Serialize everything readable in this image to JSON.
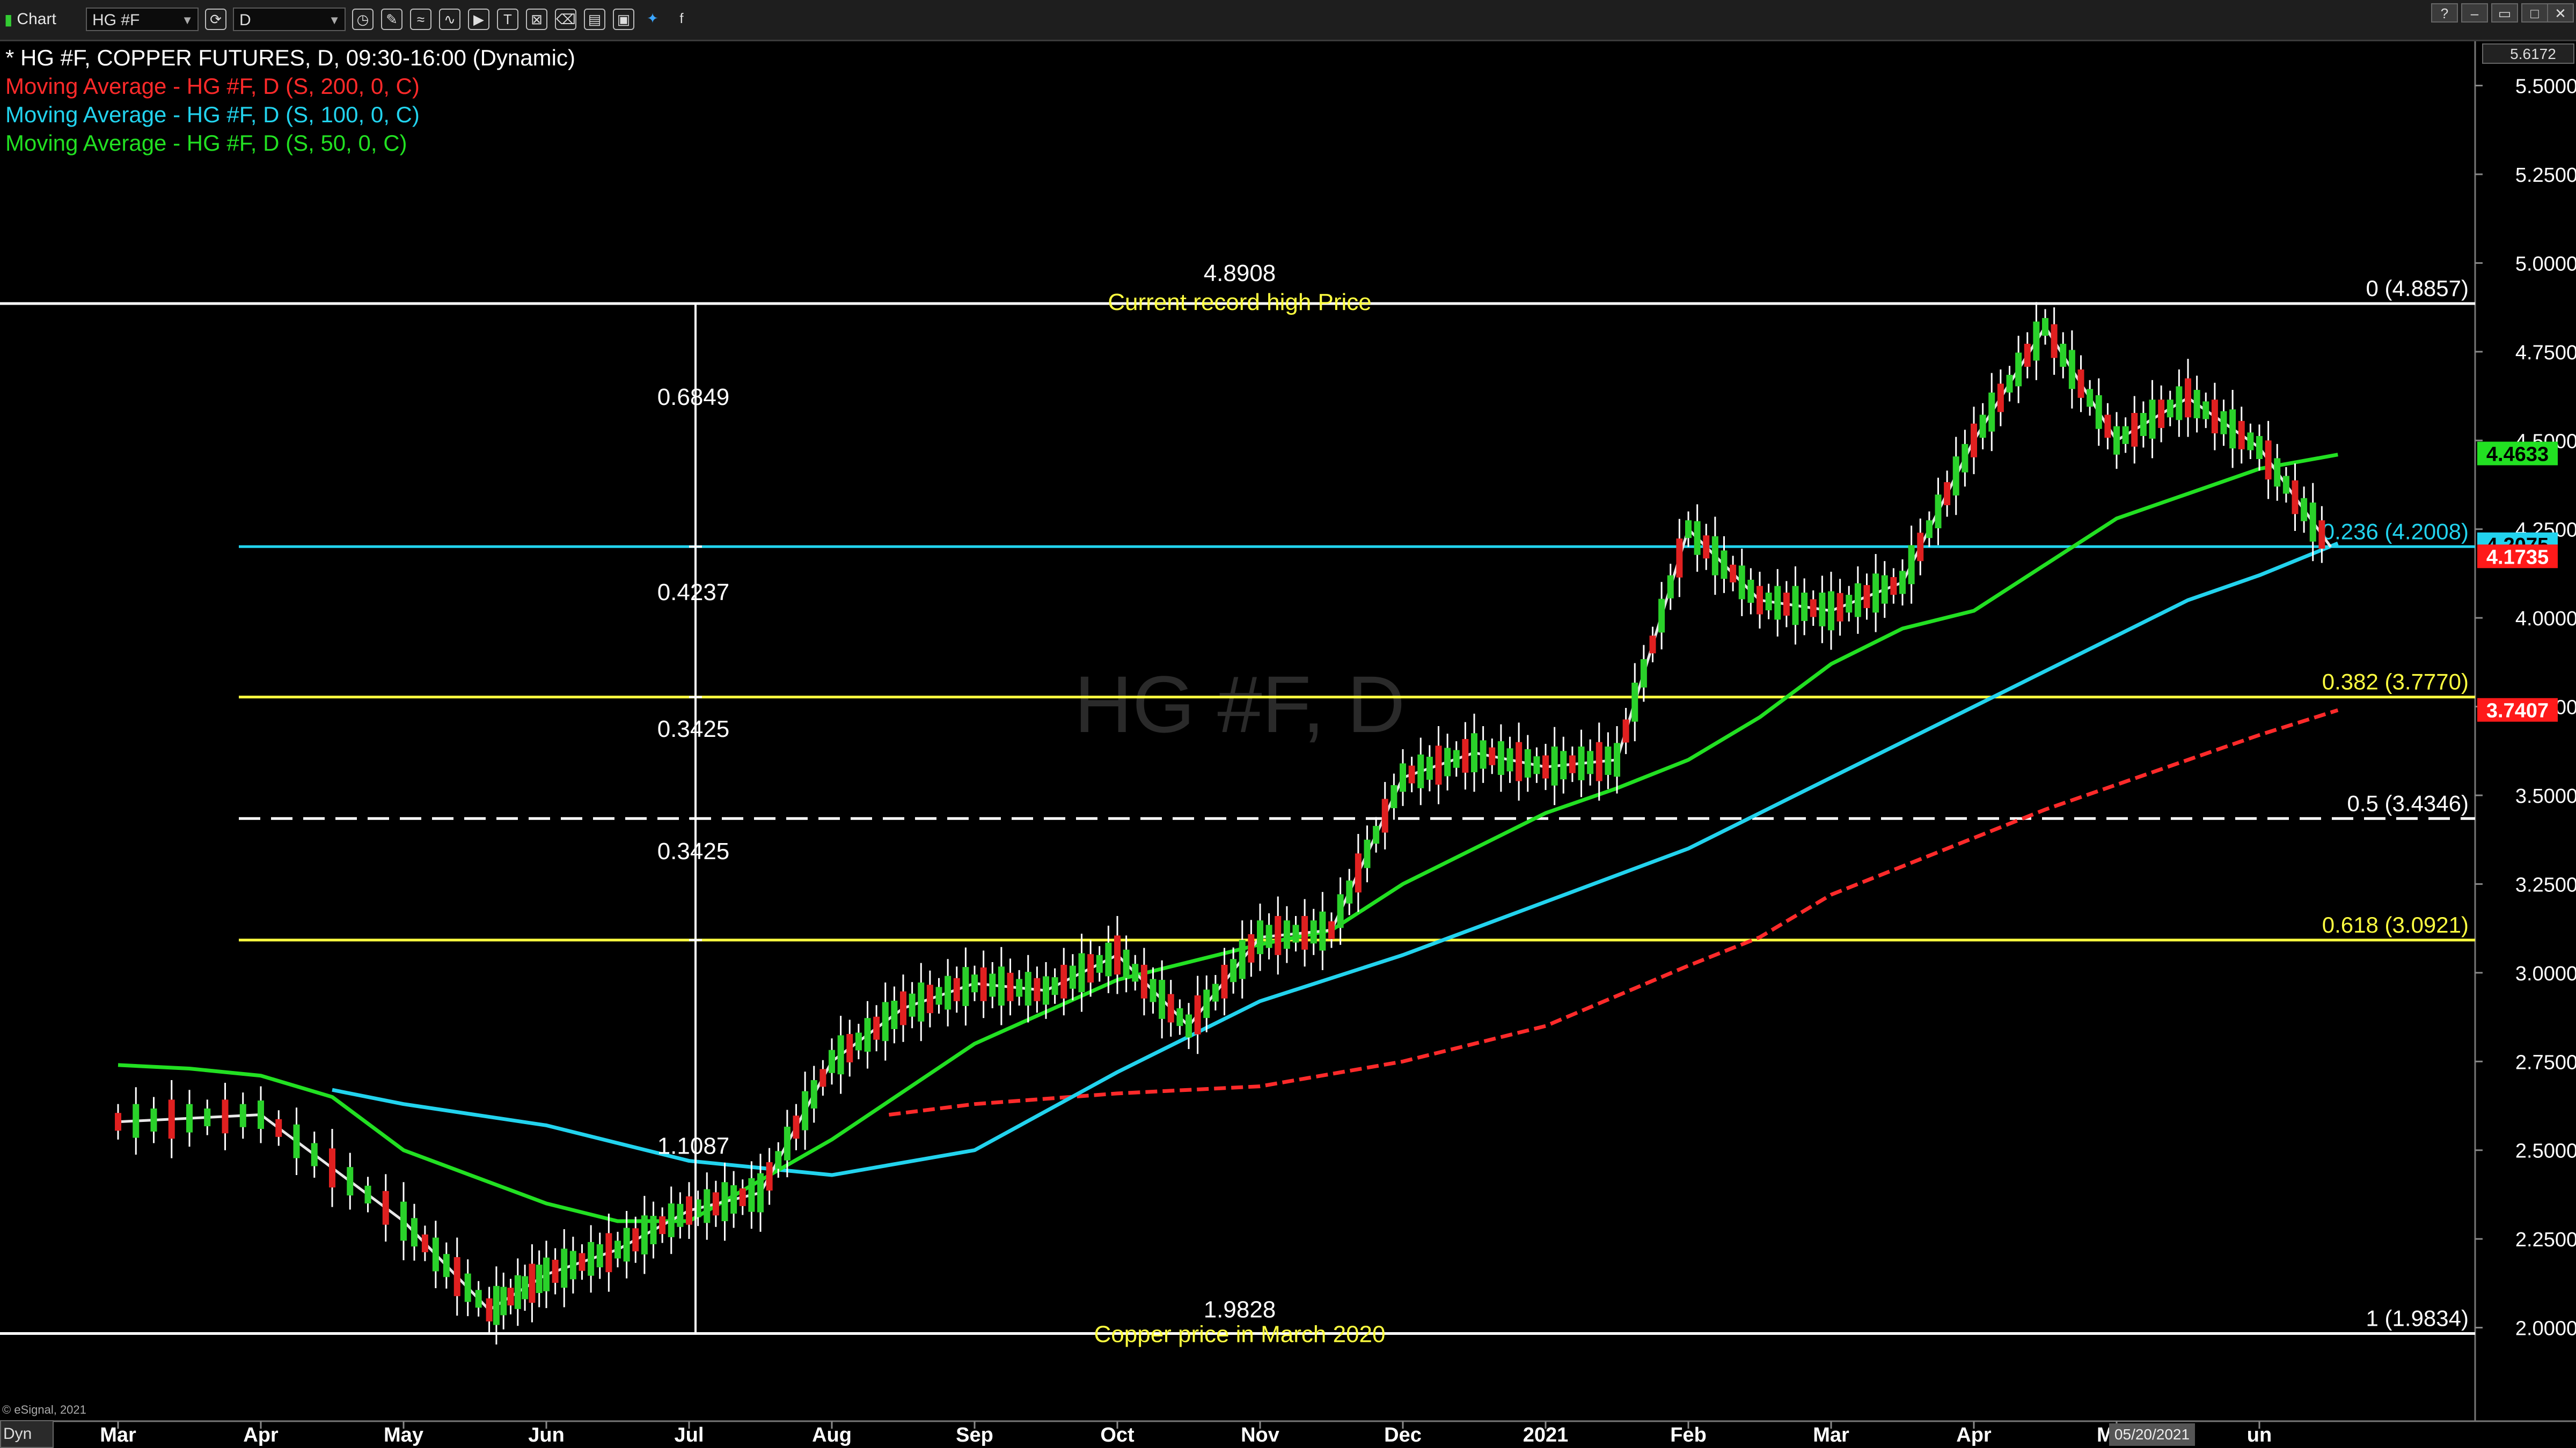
{
  "toolbar": {
    "app_label": "Chart",
    "symbol_value": "HG #F",
    "interval_value": "D"
  },
  "legend": [
    {
      "text": "* HG #F, COPPER FUTURES, D, 09:30-16:00 (Dynamic)",
      "color": "#ffffff"
    },
    {
      "text": "Moving Average - HG #F, D (S, 200, 0, C)",
      "color": "#ff2a2a"
    },
    {
      "text": "Moving Average - HG #F, D (S, 100, 0, C)",
      "color": "#22d3ee"
    },
    {
      "text": "Moving Average - HG #F, D (S, 50, 0, C)",
      "color": "#22e022"
    }
  ],
  "watermark": "HG #F, D",
  "footer": {
    "dyn_label": "Dyn",
    "copyright": "© eSignal, 2021",
    "date_tag": "05/20/2021"
  },
  "chart_data": {
    "type": "line",
    "months": [
      "Mar",
      "Apr",
      "May",
      "Jun",
      "Jul",
      "Aug",
      "Sep",
      "Oct",
      "Nov",
      "Dec",
      "2021",
      "Feb",
      "Mar",
      "Apr",
      "May",
      "un"
    ],
    "y_ticks": [
      "2.0000",
      "2.2500",
      "2.5000",
      "2.7500",
      "3.0000",
      "3.2500",
      "3.5000",
      "3.7500",
      "4.0000",
      "4.2500",
      "4.5000",
      "4.7500",
      "5.0000",
      "5.2500",
      "5.5000"
    ],
    "ylim": [
      1.75,
      5.6172
    ],
    "axis_top_label": "5.6172",
    "price_tags": [
      {
        "label": "4.4633",
        "value": 4.4633,
        "bg": "#22e022",
        "fg": "#000000"
      },
      {
        "label": "4.2075",
        "value": 4.2075,
        "bg": "#22d3ee",
        "fg": "#000000"
      },
      {
        "label": "4.1735",
        "value": 4.1735,
        "bg": "#ff1a1a",
        "fg": "#ffffff"
      },
      {
        "label": "3.7407",
        "value": 3.7407,
        "bg": "#ff1a1a",
        "fg": "#ffffff"
      }
    ],
    "fib_levels": [
      {
        "label": "0 (4.8857)",
        "value": 4.8857,
        "color": "#ffffff",
        "style": "solid"
      },
      {
        "label": "0.236 (4.2008)",
        "value": 4.2008,
        "color": "#22d3ee",
        "style": "solid"
      },
      {
        "label": "0.382 (3.7770)",
        "value": 3.777,
        "color": "#ffff40",
        "style": "solid"
      },
      {
        "label": "0.5 (3.4346)",
        "value": 3.4346,
        "color": "#ffffff",
        "style": "dashed"
      },
      {
        "label": "0.618 (3.0921)",
        "value": 3.0921,
        "color": "#ffff40",
        "style": "solid"
      },
      {
        "label": "1 (1.9834)",
        "value": 1.9834,
        "color": "#ffffff",
        "style": "solid"
      }
    ],
    "annotations": {
      "high_value": "4.8908",
      "high_text": "Current record high Price",
      "low_value": "1.9828",
      "low_text": "Copper price in March 2020",
      "segment_labels": [
        {
          "text": "0.6849",
          "value": 4.6
        },
        {
          "text": "0.4237",
          "value": 4.05
        },
        {
          "text": "0.3425",
          "value": 3.665
        },
        {
          "text": "0.3425",
          "value": 3.32
        },
        {
          "text": "1.1087",
          "value": 2.49
        }
      ]
    },
    "series": [
      {
        "name": "HG #F",
        "color": "#ffffff",
        "x": [
          0,
          1,
          2,
          2.6,
          3,
          3.5,
          4,
          4.5,
          5,
          5.5,
          6,
          6.5,
          7,
          7.5,
          8,
          8.5,
          9,
          9.5,
          10,
          10.5,
          11,
          11.5,
          12,
          12.5,
          13,
          13.5,
          14,
          14.5,
          15,
          15.5
        ],
        "values": [
          2.58,
          2.6,
          2.3,
          2.05,
          2.15,
          2.22,
          2.33,
          2.38,
          2.75,
          2.9,
          2.97,
          2.95,
          3.05,
          2.85,
          3.1,
          3.12,
          3.55,
          3.62,
          3.58,
          3.6,
          4.25,
          4.05,
          4.02,
          4.1,
          4.5,
          4.82,
          4.5,
          4.62,
          4.48,
          4.2
        ]
      },
      {
        "name": "Moving Average - HG #F, D (S, 200, 0, C)",
        "color": "#ff2a2a",
        "x": [
          5.4,
          6,
          7,
          8,
          9,
          10,
          11,
          11.5,
          12,
          12.5,
          13,
          13.5,
          14,
          14.5,
          15,
          15.55
        ],
        "values": [
          2.6,
          2.63,
          2.66,
          2.68,
          2.75,
          2.85,
          3.02,
          3.1,
          3.22,
          3.3,
          3.38,
          3.46,
          3.53,
          3.6,
          3.67,
          3.74
        ]
      },
      {
        "name": "Moving Average - HG #F, D (S, 100, 0, C)",
        "color": "#22d3ee",
        "x": [
          1.5,
          2,
          3,
          4,
          5,
          6,
          7,
          8,
          9,
          10,
          11,
          11.5,
          12,
          12.5,
          13,
          13.5,
          14,
          14.5,
          15,
          15.55
        ],
        "values": [
          2.67,
          2.63,
          2.57,
          2.47,
          2.43,
          2.5,
          2.72,
          2.92,
          3.05,
          3.2,
          3.35,
          3.45,
          3.55,
          3.65,
          3.75,
          3.85,
          3.95,
          4.05,
          4.12,
          4.21
        ]
      },
      {
        "name": "Moving Average - HG #F, D (S, 50, 0, C)",
        "color": "#22e022",
        "x": [
          0,
          0.5,
          1,
          1.5,
          2,
          3,
          3.5,
          4,
          5,
          6,
          7,
          8,
          8.5,
          9,
          10,
          10.5,
          11,
          11.5,
          12,
          12.5,
          13,
          13.5,
          14,
          14.5,
          15,
          15.55
        ],
        "values": [
          2.74,
          2.73,
          2.71,
          2.65,
          2.5,
          2.35,
          2.3,
          2.3,
          2.53,
          2.8,
          2.98,
          3.08,
          3.12,
          3.25,
          3.45,
          3.52,
          3.6,
          3.72,
          3.87,
          3.97,
          4.02,
          4.15,
          4.28,
          4.35,
          4.42,
          4.46
        ]
      }
    ]
  }
}
